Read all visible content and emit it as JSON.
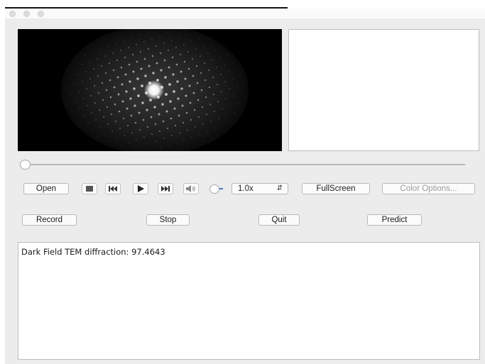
{
  "player": {
    "open_label": "Open",
    "speed_value": "1.0x",
    "fullscreen_label": "FullScreen",
    "color_options_label": "Color Options...",
    "position": 0
  },
  "actions": {
    "record_label": "Record",
    "stop_label": "Stop",
    "quit_label": "Quit",
    "predict_label": "Predict"
  },
  "output": {
    "text": "Dark Field TEM diffraction: 97.4643"
  },
  "icons": [
    "stop-icon",
    "skip-back-icon",
    "play-icon",
    "skip-forward-icon",
    "volume-icon"
  ],
  "colors": {
    "accent": "#3a7bd5",
    "window_bg": "#ececec",
    "video_bg": "#000000"
  }
}
